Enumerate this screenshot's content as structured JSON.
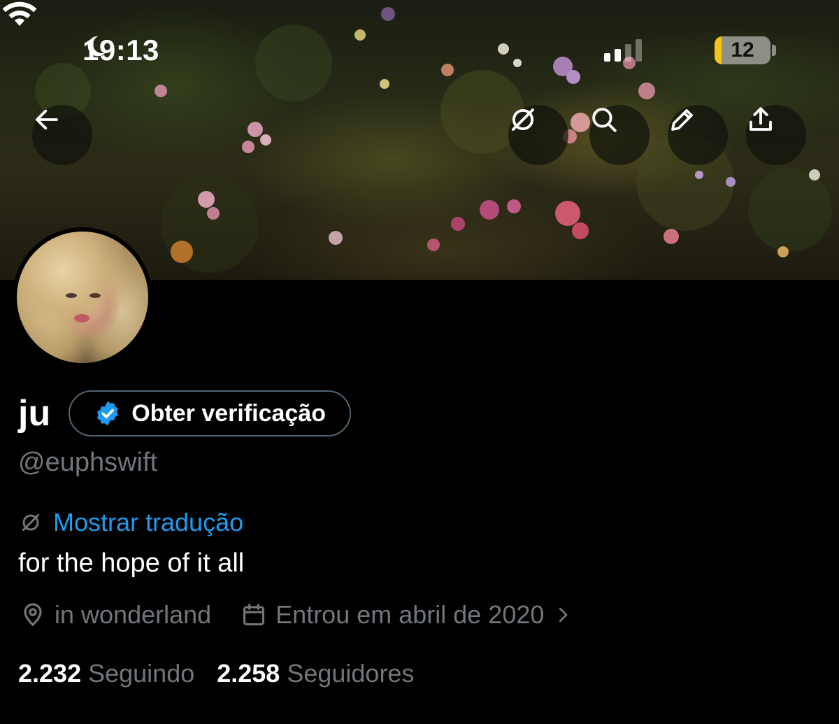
{
  "status_bar": {
    "time": "19:13",
    "battery_level": "12",
    "battery_fraction": 0.12,
    "signal_bars_active": 2,
    "signal_bars_total": 4,
    "icons": [
      "moon-icon",
      "cellular-signal-icon",
      "wifi-icon",
      "battery-icon"
    ]
  },
  "toolbar": {
    "buttons": [
      "back-arrow-icon",
      "translate-icon",
      "search-icon",
      "edit-pencil-icon",
      "share-icon"
    ]
  },
  "profile": {
    "display_name": "ju",
    "verify_label": "Obter verificação",
    "handle": "@euphswift",
    "translate_label": "Mostrar tradução",
    "bio": "for the hope of it all",
    "location": "in wonderland",
    "joined": "Entrou em abril de 2020",
    "following_count": "2.232",
    "following_label": "Seguindo",
    "followers_count": "2.258",
    "followers_label": "Seguidores"
  },
  "colors": {
    "background": "#000000",
    "text_primary": "#ffffff",
    "text_secondary": "#71767b",
    "link": "#1d9bf0",
    "verified_badge": "#1d9bf0",
    "battery_fill": "#f5c518"
  }
}
